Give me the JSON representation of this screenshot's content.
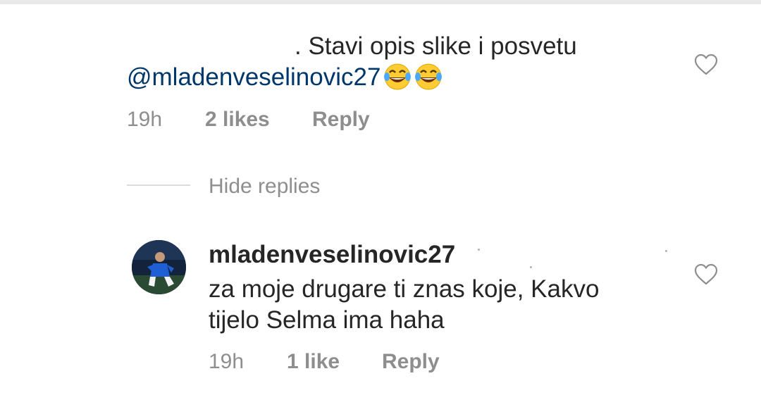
{
  "parent_comment": {
    "text": ". Stavi opis slike i posvetu",
    "mention": "@mladenveselinovic27",
    "emoji": [
      "face-with-tears-of-joy",
      "face-with-tears-of-joy"
    ],
    "time": "19h",
    "likes": "2 likes",
    "reply": "Reply"
  },
  "replies_toggle": {
    "label": "Hide replies"
  },
  "reply_comment": {
    "username": "mladenveselinovic27",
    "text_line1": "za moje drugare ti znas koje, Kakvo",
    "text_line2": "tijelo Selma ima haha",
    "time": "19h",
    "likes": "1 like",
    "reply": "Reply"
  },
  "icons": {
    "like": "heart-outline-icon"
  },
  "colors": {
    "text": "#262626",
    "mention": "#00376b",
    "meta": "#8e8e8e",
    "divider": "#dbdbdb"
  }
}
